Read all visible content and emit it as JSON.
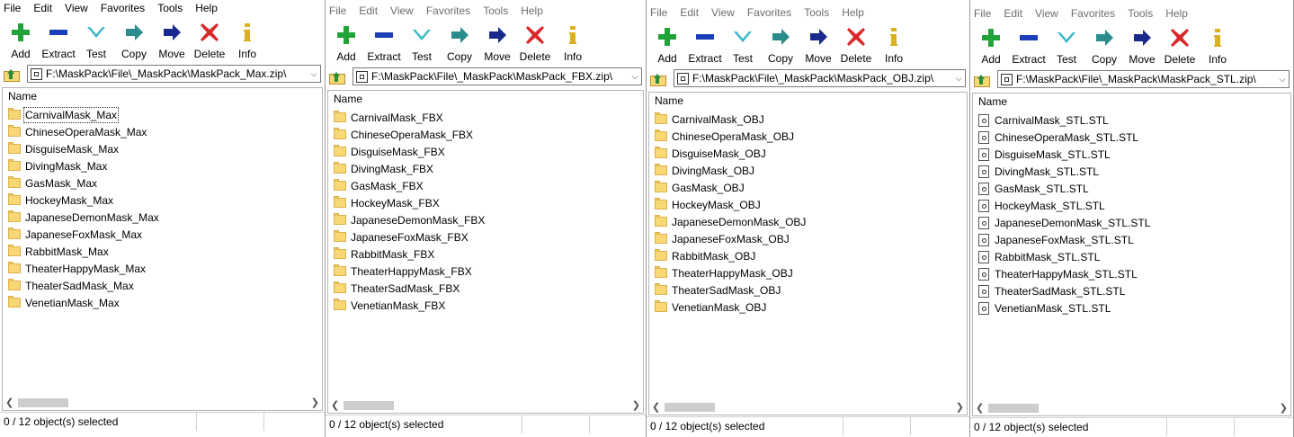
{
  "menu": [
    "File",
    "Edit",
    "View",
    "Favorites",
    "Tools",
    "Help"
  ],
  "toolbar": [
    {
      "label": "Add",
      "icon": "plus-icon",
      "color": "#22a33a"
    },
    {
      "label": "Extract",
      "icon": "minus-icon",
      "color": "#1a3fb8"
    },
    {
      "label": "Test",
      "icon": "check-icon",
      "color": "#3ab8c8"
    },
    {
      "label": "Copy",
      "icon": "copy-arrow-icon",
      "color": "#2a8c8c"
    },
    {
      "label": "Move",
      "icon": "move-arrow-icon",
      "color": "#1a2a8c"
    },
    {
      "label": "Delete",
      "icon": "x-icon",
      "color": "#d8282a"
    },
    {
      "label": "Info",
      "icon": "info-icon",
      "color": "#d8b020"
    }
  ],
  "column_header": "Name",
  "windows": [
    {
      "path": "F:\\MaskPack\\File\\_MaskPack\\MaskPack_Max.zip\\",
      "status": "0 / 12 object(s) selected",
      "item_type": "folder",
      "items": [
        "CarnivalMask_Max",
        "ChineseOperaMask_Max",
        "DisguiseMask_Max",
        "DivingMask_Max",
        "GasMask_Max",
        "HockeyMask_Max",
        "JapaneseDemonMask_Max",
        "JapaneseFoxMask_Max",
        "RabbitMask_Max",
        "TheaterHappyMask_Max",
        "TheaterSadMask_Max",
        "VenetianMask_Max"
      ]
    },
    {
      "path": "F:\\MaskPack\\File\\_MaskPack\\MaskPack_FBX.zip\\",
      "status": "0 / 12 object(s) selected",
      "item_type": "folder",
      "items": [
        "CarnivalMask_FBX",
        "ChineseOperaMask_FBX",
        "DisguiseMask_FBX",
        "DivingMask_FBX",
        "GasMask_FBX",
        "HockeyMask_FBX",
        "JapaneseDemonMask_FBX",
        "JapaneseFoxMask_FBX",
        "RabbitMask_FBX",
        "TheaterHappyMask_FBX",
        "TheaterSadMask_FBX",
        "VenetianMask_FBX"
      ]
    },
    {
      "path": "F:\\MaskPack\\File\\_MaskPack\\MaskPack_OBJ.zip\\",
      "status": "0 / 12 object(s) selected",
      "item_type": "folder",
      "items": [
        "CarnivalMask_OBJ",
        "ChineseOperaMask_OBJ",
        "DisguiseMask_OBJ",
        "DivingMask_OBJ",
        "GasMask_OBJ",
        "HockeyMask_OBJ",
        "JapaneseDemonMask_OBJ",
        "JapaneseFoxMask_OBJ",
        "RabbitMask_OBJ",
        "TheaterHappyMask_OBJ",
        "TheaterSadMask_OBJ",
        "VenetianMask_OBJ"
      ]
    },
    {
      "path": "F:\\MaskPack\\File\\_MaskPack\\MaskPack_STL.zip\\",
      "status": "0 / 12 object(s) selected",
      "item_type": "file",
      "items": [
        "CarnivalMask_STL.STL",
        "ChineseOperaMask_STL.STL",
        "DisguiseMask_STL.STL",
        "DivingMask_STL.STL",
        "GasMask_STL.STL",
        "HockeyMask_STL.STL",
        "JapaneseDemonMask_STL.STL",
        "JapaneseFoxMask_STL.STL",
        "RabbitMask_STL.STL",
        "TheaterHappyMask_STL.STL",
        "TheaterSadMask_STL.STL",
        "VenetianMask_STL.STL"
      ]
    }
  ]
}
